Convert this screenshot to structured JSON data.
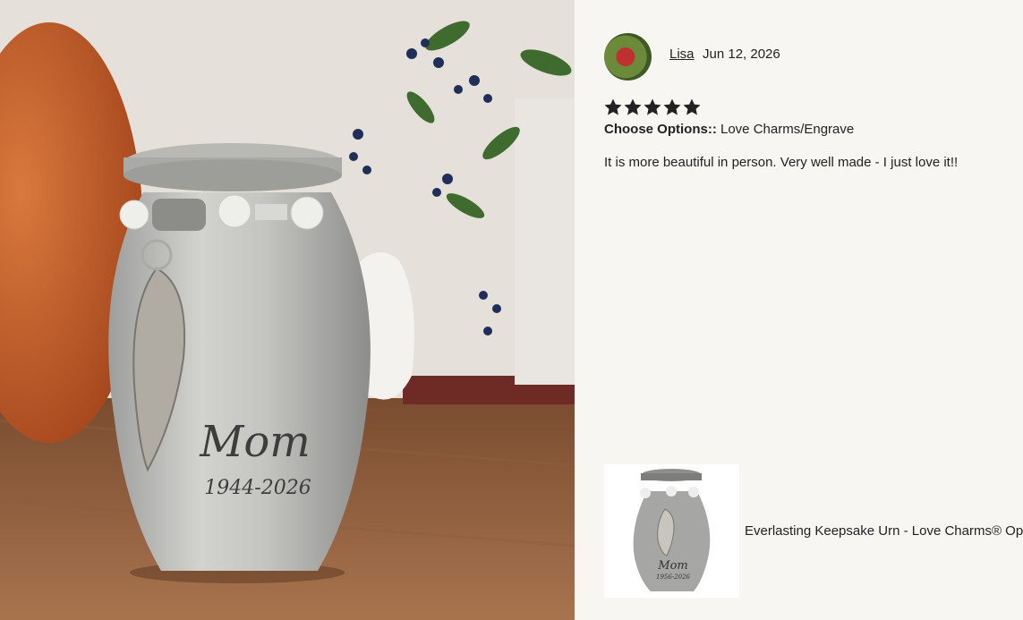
{
  "photo": {
    "engraving_name": "Mom",
    "engraving_years": "1944-2026",
    "icon": "urn-photo"
  },
  "review": {
    "reviewer_name": "Lisa",
    "date": "Jun 12, 2026",
    "rating": 5,
    "rating_max": 5,
    "options_label": "Choose Options::",
    "options_value": " Love Charms/Engrave",
    "text": "It is more beautiful in person. Very well made - I just love it!!",
    "star_color": "#222222"
  },
  "product": {
    "thumb_engraving_name": "Mom",
    "thumb_engraving_years": "1956-2026",
    "title": "Everlasting Keepsake Urn - Love Charms® Opt"
  }
}
